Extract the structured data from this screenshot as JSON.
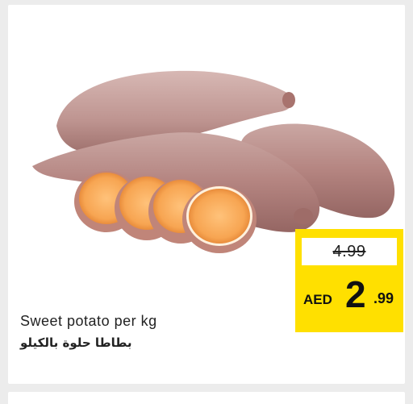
{
  "product": {
    "title_en": "Sweet potato per kg",
    "title_ar": "بطاطا حلوة بالكيلو",
    "image_icon": "sweet-potato-image"
  },
  "price": {
    "old_price": "4.99",
    "currency": "AED",
    "new_price_integer": "2",
    "new_price_decimal": ".99"
  },
  "colors": {
    "badge_background": "#ffe000",
    "card_background": "#ffffff",
    "page_background": "#ececec"
  }
}
